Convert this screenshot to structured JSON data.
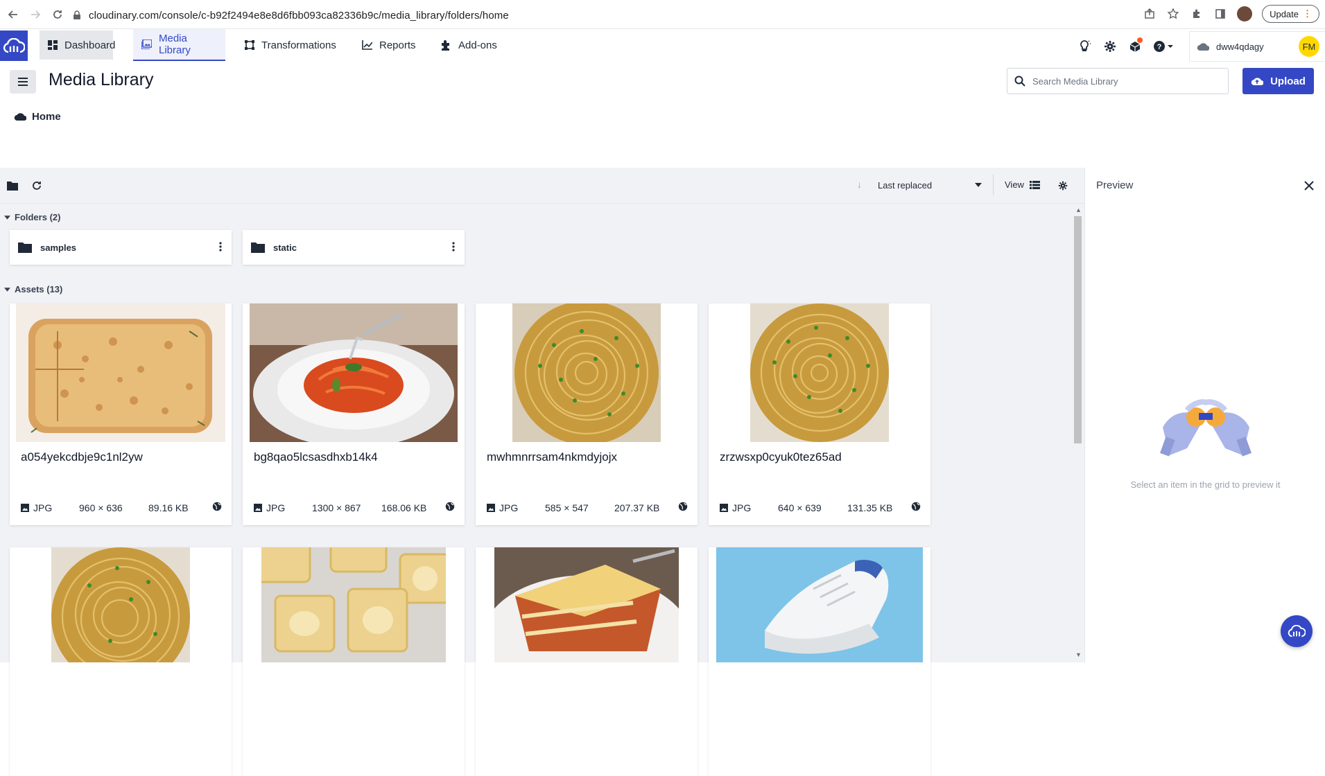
{
  "browser": {
    "url": "cloudinary.com/console/c-b92f2494e8e8d6fbb093ca82336b9c/media_library/folders/home",
    "update_label": "Update"
  },
  "nav": {
    "tabs": [
      {
        "label": "Dashboard",
        "icon": "dashboard-icon"
      },
      {
        "label": "Media Library",
        "icon": "media-library-icon",
        "active": true
      },
      {
        "label": "Transformations",
        "icon": "transformations-icon"
      },
      {
        "label": "Reports",
        "icon": "reports-icon"
      },
      {
        "label": "Add-ons",
        "icon": "addons-icon"
      }
    ],
    "account_name": "dww4qdagy",
    "avatar_initials": "FM"
  },
  "page": {
    "title": "Media Library",
    "search_placeholder": "Search Media Library",
    "upload_label": "Upload",
    "breadcrumb_home": "Home"
  },
  "toolbar": {
    "sort_label": "Last replaced",
    "view_label": "View"
  },
  "folders": {
    "heading": "Folders (2)",
    "items": [
      {
        "name": "samples"
      },
      {
        "name": "static"
      }
    ]
  },
  "assets": {
    "heading": "Assets (13)",
    "items": [
      {
        "name": "a054yekcdbje9c1nl2yw",
        "format": "JPG",
        "dims": "960 × 636",
        "size": "89.16 KB"
      },
      {
        "name": "bg8qao5lcsasdhxb14k4",
        "format": "JPG",
        "dims": "1300 × 867",
        "size": "168.06 KB"
      },
      {
        "name": "mwhmnrrsam4nkmdyjojx",
        "format": "JPG",
        "dims": "585 × 547",
        "size": "207.37 KB"
      },
      {
        "name": "zrzwsxp0cyuk0tez65ad",
        "format": "JPG",
        "dims": "640 × 639",
        "size": "131.35 KB"
      }
    ]
  },
  "preview": {
    "title": "Preview",
    "hint": "Select an item in the grid to preview it"
  },
  "colors": {
    "brand": "#3448c5",
    "avatar": "#ffd800",
    "content_bg": "#f1f2f5"
  }
}
